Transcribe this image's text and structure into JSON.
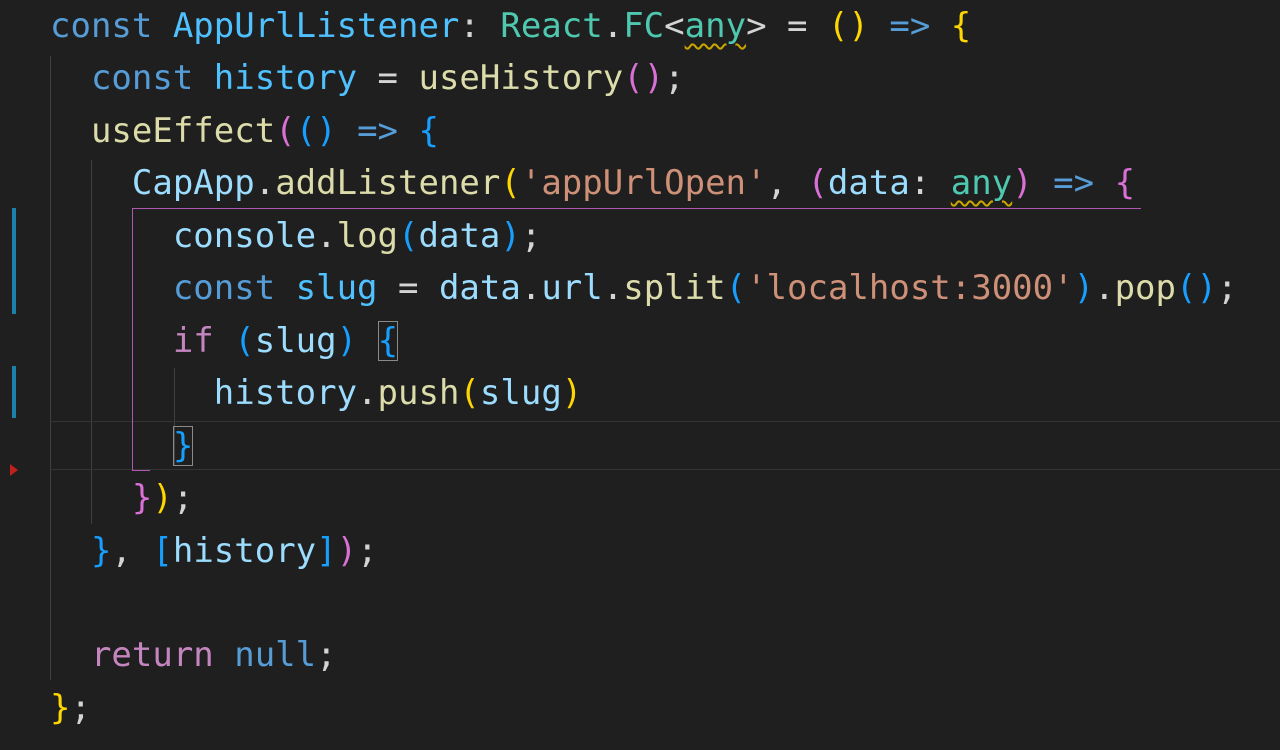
{
  "colors": {
    "background": "#1f1f1f",
    "keyword": "#569cd6",
    "variable": "#9cdcfe",
    "function": "#dcdcaa",
    "type": "#4ec9b0",
    "string": "#ce9178",
    "control": "#c586c0",
    "operator": "#d4d4d4",
    "bracket1": "#ffd700",
    "bracket2": "#da70d6",
    "bracket3": "#179fff",
    "constant": "#569cd6",
    "gutter_modified": "#1b81a8"
  },
  "code_lines": [
    {
      "tokens": [
        {
          "t": "const ",
          "c": "#569cd6"
        },
        {
          "t": "AppUrlListener",
          "c": "#4fc1ff"
        },
        {
          "t": ": ",
          "c": "#d4d4d4"
        },
        {
          "t": "React",
          "c": "#4ec9b0"
        },
        {
          "t": ".",
          "c": "#d4d4d4"
        },
        {
          "t": "FC",
          "c": "#4ec9b0"
        },
        {
          "t": "<",
          "c": "#d4d4d4"
        },
        {
          "t": "any",
          "c": "#4ec9b0",
          "squiggle": true
        },
        {
          "t": "> = ",
          "c": "#d4d4d4"
        },
        {
          "t": "()",
          "c": "#ffd700"
        },
        {
          "t": " => ",
          "c": "#569cd6"
        },
        {
          "t": "{",
          "c": "#ffd700"
        }
      ]
    },
    {
      "tokens": [
        {
          "t": "  const ",
          "c": "#569cd6"
        },
        {
          "t": "history",
          "c": "#4fc1ff"
        },
        {
          "t": " = ",
          "c": "#d4d4d4"
        },
        {
          "t": "useHistory",
          "c": "#dcdcaa"
        },
        {
          "t": "()",
          "c": "#da70d6"
        },
        {
          "t": ";",
          "c": "#d4d4d4"
        }
      ]
    },
    {
      "tokens": [
        {
          "t": "  useEffect",
          "c": "#dcdcaa"
        },
        {
          "t": "(",
          "c": "#da70d6"
        },
        {
          "t": "()",
          "c": "#179fff"
        },
        {
          "t": " => ",
          "c": "#569cd6"
        },
        {
          "t": "{",
          "c": "#179fff"
        }
      ]
    },
    {
      "tokens": [
        {
          "t": "    CapApp",
          "c": "#9cdcfe"
        },
        {
          "t": ".",
          "c": "#d4d4d4"
        },
        {
          "t": "addListener",
          "c": "#dcdcaa"
        },
        {
          "t": "(",
          "c": "#ffd700"
        },
        {
          "t": "'appUrlOpen'",
          "c": "#ce9178"
        },
        {
          "t": ", ",
          "c": "#d4d4d4"
        },
        {
          "t": "(",
          "c": "#da70d6"
        },
        {
          "t": "data",
          "c": "#9cdcfe"
        },
        {
          "t": ": ",
          "c": "#d4d4d4"
        },
        {
          "t": "any",
          "c": "#4ec9b0",
          "squiggle": true
        },
        {
          "t": ")",
          "c": "#da70d6"
        },
        {
          "t": " => ",
          "c": "#569cd6"
        },
        {
          "t": "{",
          "c": "#da70d6"
        }
      ]
    },
    {
      "tokens": [
        {
          "t": "      console",
          "c": "#9cdcfe"
        },
        {
          "t": ".",
          "c": "#d4d4d4"
        },
        {
          "t": "log",
          "c": "#dcdcaa"
        },
        {
          "t": "(",
          "c": "#179fff"
        },
        {
          "t": "data",
          "c": "#9cdcfe"
        },
        {
          "t": ")",
          "c": "#179fff"
        },
        {
          "t": ";",
          "c": "#d4d4d4"
        }
      ]
    },
    {
      "tokens": [
        {
          "t": "      const ",
          "c": "#569cd6"
        },
        {
          "t": "slug",
          "c": "#4fc1ff"
        },
        {
          "t": " = ",
          "c": "#d4d4d4"
        },
        {
          "t": "data",
          "c": "#9cdcfe"
        },
        {
          "t": ".",
          "c": "#d4d4d4"
        },
        {
          "t": "url",
          "c": "#9cdcfe"
        },
        {
          "t": ".",
          "c": "#d4d4d4"
        },
        {
          "t": "split",
          "c": "#dcdcaa"
        },
        {
          "t": "(",
          "c": "#179fff"
        },
        {
          "t": "'localhost:3000'",
          "c": "#ce9178"
        },
        {
          "t": ")",
          "c": "#179fff"
        },
        {
          "t": ".",
          "c": "#d4d4d4"
        },
        {
          "t": "pop",
          "c": "#dcdcaa"
        },
        {
          "t": "()",
          "c": "#179fff"
        },
        {
          "t": ";",
          "c": "#d4d4d4"
        }
      ]
    },
    {
      "tokens": [
        {
          "t": "      if ",
          "c": "#c586c0"
        },
        {
          "t": "(",
          "c": "#179fff"
        },
        {
          "t": "slug",
          "c": "#9cdcfe"
        },
        {
          "t": ") ",
          "c": "#179fff"
        },
        {
          "t": "{",
          "c": "#179fff",
          "box": true
        }
      ]
    },
    {
      "tokens": [
        {
          "t": "        history",
          "c": "#9cdcfe"
        },
        {
          "t": ".",
          "c": "#d4d4d4"
        },
        {
          "t": "push",
          "c": "#dcdcaa"
        },
        {
          "t": "(",
          "c": "#ffd700"
        },
        {
          "t": "slug",
          "c": "#9cdcfe"
        },
        {
          "t": ")",
          "c": "#ffd700"
        }
      ]
    },
    {
      "tokens": [
        {
          "t": "      ",
          "c": "#d4d4d4"
        },
        {
          "t": "}",
          "c": "#179fff",
          "box": true
        }
      ]
    },
    {
      "tokens": [
        {
          "t": "    }",
          "c": "#da70d6"
        },
        {
          "t": ")",
          "c": "#ffd700"
        },
        {
          "t": ";",
          "c": "#d4d4d4"
        }
      ]
    },
    {
      "tokens": [
        {
          "t": "  }",
          "c": "#179fff"
        },
        {
          "t": ", ",
          "c": "#d4d4d4"
        },
        {
          "t": "[",
          "c": "#179fff"
        },
        {
          "t": "history",
          "c": "#9cdcfe"
        },
        {
          "t": "]",
          "c": "#179fff"
        },
        {
          "t": ")",
          "c": "#da70d6"
        },
        {
          "t": ";",
          "c": "#d4d4d4"
        }
      ]
    },
    {
      "tokens": []
    },
    {
      "tokens": [
        {
          "t": "  return ",
          "c": "#c586c0"
        },
        {
          "t": "null",
          "c": "#569cd6"
        },
        {
          "t": ";",
          "c": "#d4d4d4"
        }
      ]
    },
    {
      "tokens": [
        {
          "t": "}",
          "c": "#ffd700"
        },
        {
          "t": ";",
          "c": "#d4d4d4"
        }
      ]
    }
  ]
}
